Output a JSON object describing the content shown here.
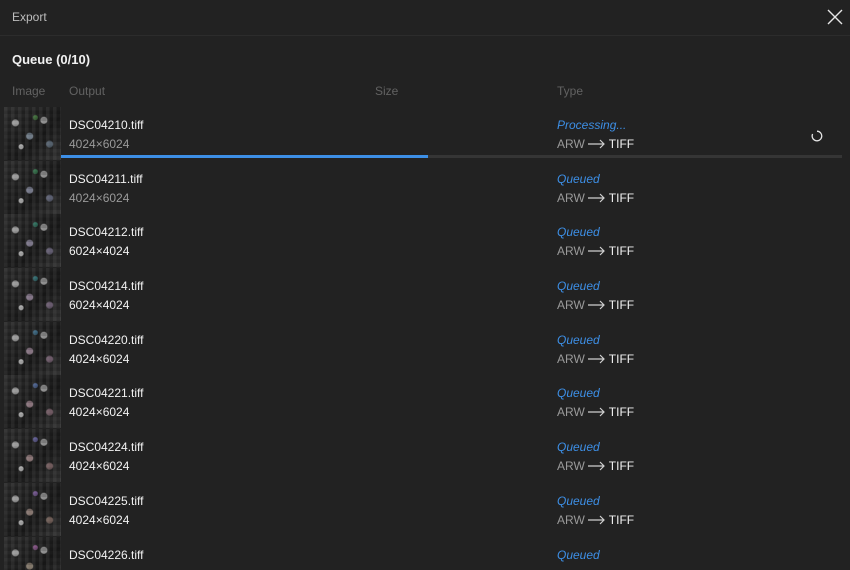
{
  "window": {
    "title": "Export",
    "close_icon": "close-icon"
  },
  "queue": {
    "heading": "Queue (0/10)",
    "columns": {
      "image": "Image",
      "output": "Output",
      "size": "Size",
      "type": "Type"
    },
    "items": [
      {
        "filename": "DSC04210.tiff",
        "dimensions": "4024×6024",
        "status": "Processing...",
        "from": "ARW",
        "to": "TIFF",
        "progress": 0.47,
        "dims_dim": true
      },
      {
        "filename": "DSC04211.tiff",
        "dimensions": "4024×6024",
        "status": "Queued",
        "from": "ARW",
        "to": "TIFF",
        "dims_dim": true
      },
      {
        "filename": "DSC04212.tiff",
        "dimensions": "6024×4024",
        "status": "Queued",
        "from": "ARW",
        "to": "TIFF",
        "dims_dim": false
      },
      {
        "filename": "DSC04214.tiff",
        "dimensions": "6024×4024",
        "status": "Queued",
        "from": "ARW",
        "to": "TIFF",
        "dims_dim": false
      },
      {
        "filename": "DSC04220.tiff",
        "dimensions": "4024×6024",
        "status": "Queued",
        "from": "ARW",
        "to": "TIFF",
        "dims_dim": false
      },
      {
        "filename": "DSC04221.tiff",
        "dimensions": "4024×6024",
        "status": "Queued",
        "from": "ARW",
        "to": "TIFF",
        "dims_dim": false
      },
      {
        "filename": "DSC04224.tiff",
        "dimensions": "4024×6024",
        "status": "Queued",
        "from": "ARW",
        "to": "TIFF",
        "dims_dim": false
      },
      {
        "filename": "DSC04225.tiff",
        "dimensions": "4024×6024",
        "status": "Queued",
        "from": "ARW",
        "to": "TIFF",
        "dims_dim": false
      },
      {
        "filename": "DSC04226.tiff",
        "status": "Queued"
      }
    ]
  },
  "colors": {
    "background": "#222222",
    "accent": "#3d8fe6",
    "text_primary": "#f2f2f2",
    "text_dim": "#9a9a9a",
    "header_text": "#626262"
  },
  "icons": {
    "spinner": "loading-spinner-icon",
    "arrow": "arrow-right-icon"
  }
}
